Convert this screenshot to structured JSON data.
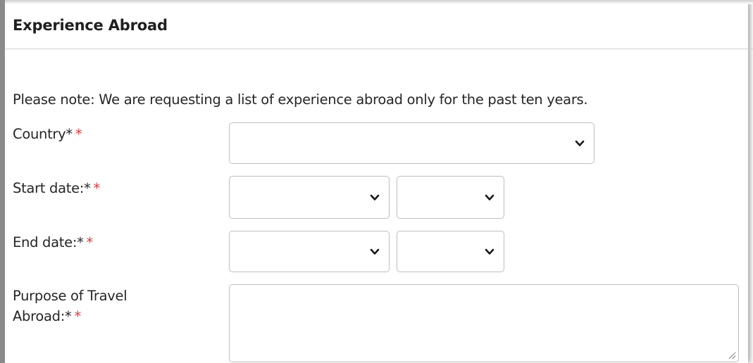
{
  "section": {
    "title": "Experience Abroad",
    "note": "Please note: We are requesting a list of experience abroad only for the past ten years."
  },
  "fields": {
    "country": {
      "label": "Country*",
      "required_mark": "*",
      "value": ""
    },
    "start_date": {
      "label": "Start date:*",
      "required_mark": "*",
      "month_value": "",
      "year_value": ""
    },
    "end_date": {
      "label": "End date:*",
      "required_mark": "*",
      "month_value": "",
      "year_value": ""
    },
    "purpose": {
      "label_line1": "Purpose of Travel",
      "label_line2": "Abroad:*",
      "required_mark": "*",
      "value": ""
    }
  },
  "icons": {
    "dropdown": "chevron-down-icon",
    "resize": "resize-handle-icon"
  },
  "colors": {
    "required": "#e0383e",
    "border": "#bfbfbf",
    "text": "#262626"
  }
}
